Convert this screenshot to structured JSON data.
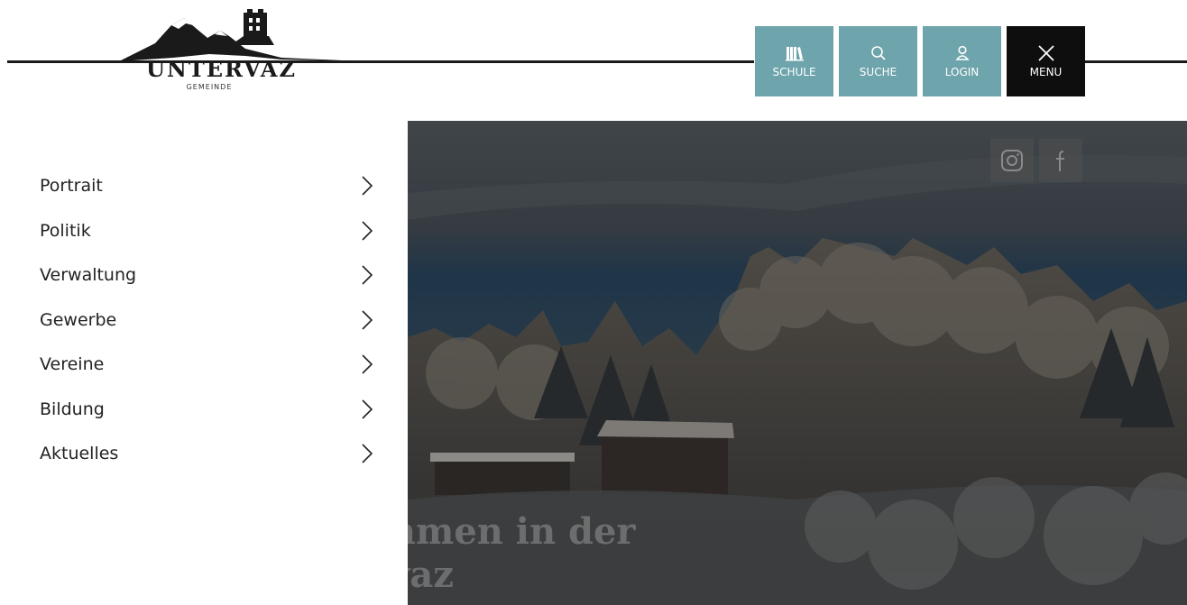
{
  "logo": {
    "title": "UNTERVAZ",
    "subtitle": "GEMEINDE"
  },
  "topnav": [
    {
      "id": "schule",
      "label": "SCHULE",
      "icon": "books-icon"
    },
    {
      "id": "suche",
      "label": "SUCHE",
      "icon": "search-icon"
    },
    {
      "id": "login",
      "label": "LOGIN",
      "icon": "user-icon"
    },
    {
      "id": "menu",
      "label": "MENU",
      "icon": "close-icon"
    }
  ],
  "sidebar": {
    "items": [
      {
        "label": "Portrait"
      },
      {
        "label": "Politik"
      },
      {
        "label": "Verwaltung"
      },
      {
        "label": "Gewerbe"
      },
      {
        "label": "Vereine"
      },
      {
        "label": "Bildung"
      },
      {
        "label": "Aktuelles"
      }
    ]
  },
  "hero": {
    "title_line1": "ommen in der",
    "title_line2": "rvaz",
    "social": [
      {
        "icon": "instagram-icon"
      },
      {
        "icon": "facebook-icon"
      }
    ]
  },
  "colors": {
    "accent": "#6ea4ab",
    "menu_button": "#0e0e0e",
    "text": "#222222"
  }
}
